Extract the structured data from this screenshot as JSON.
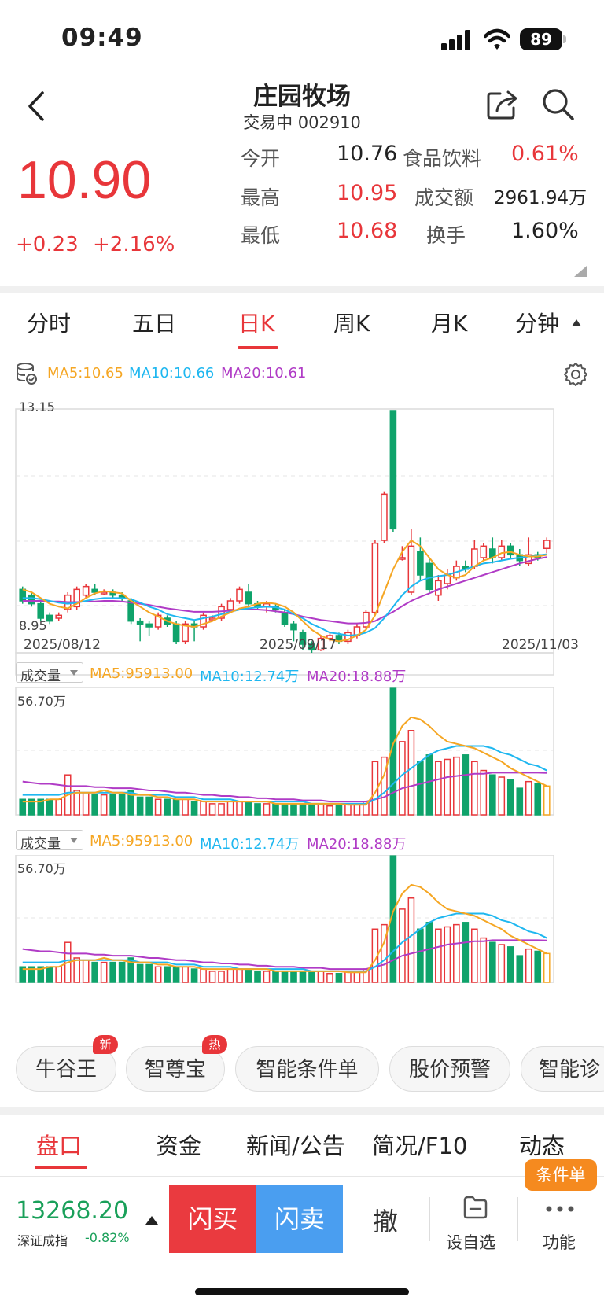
{
  "status": {
    "time": "09:49",
    "battery": "89"
  },
  "header": {
    "title": "庄园牧场",
    "subtitle": "交易中 002910"
  },
  "quote": {
    "price": "10.90",
    "change": "+0.23",
    "change_pct": "+2.16%",
    "open_label": "今开",
    "open": "10.76",
    "high_label": "最高",
    "high": "10.95",
    "low_label": "最低",
    "low": "10.68",
    "sector_label": "食品饮料",
    "sector_chg": "0.61%",
    "turnover_amt_label": "成交额",
    "turnover_amt": "2961.94万",
    "turnover_rate_label": "换手",
    "turnover_rate": "1.60%"
  },
  "tabs": [
    "分时",
    "五日",
    "日K",
    "周K",
    "月K",
    "分钟"
  ],
  "active_tab": "日K",
  "kline": {
    "ma5": "MA5:10.65",
    "ma10": "MA10:10.66",
    "ma20": "MA20:10.61",
    "ymax": "13.15",
    "ymin": "8.95",
    "dates": [
      "2025/08/12",
      "2025/09/17",
      "2025/11/03"
    ],
    "colors": {
      "up": "#e8363a",
      "down": "#0fa36b",
      "ma5": "#f5a623",
      "ma10": "#1eb7f0",
      "ma20": "#b03bc6"
    }
  },
  "volume1": {
    "selector": "成交量",
    "ma5": "MA5:95913.00",
    "ma10": "MA10:12.74万",
    "ma20": "MA20:18.88万",
    "ymax": "56.70万"
  },
  "volume2": {
    "selector": "成交量",
    "ma5": "MA5:95913.00",
    "ma10": "MA10:12.74万",
    "ma20": "MA20:18.88万",
    "ymax": "56.70万"
  },
  "chips": [
    {
      "label": "牛谷王",
      "badge": "新"
    },
    {
      "label": "智尊宝",
      "badge": "热"
    },
    {
      "label": "智能条件单",
      "badge": ""
    },
    {
      "label": "股价预警",
      "badge": ""
    },
    {
      "label": "智能诊",
      "badge": ""
    }
  ],
  "bottom_tabs": [
    "盘口",
    "资金",
    "新闻/公告",
    "简况/F10",
    "动态"
  ],
  "footer": {
    "index_value": "13268.20",
    "index_name": "深证成指",
    "index_chg": "-0.82%",
    "buy": "闪买",
    "sell": "闪卖",
    "cancel": "撤",
    "watch": "设自选",
    "func": "功能",
    "cond": "条件单"
  },
  "chart_data": {
    "type": "candlestick",
    "x_range": [
      "2025/08/12",
      "2025/11/03"
    ],
    "ylim": [
      8.95,
      13.15
    ],
    "candles": [
      {
        "o": 10.05,
        "c": 9.85,
        "h": 10.1,
        "l": 9.8
      },
      {
        "o": 9.95,
        "c": 9.8,
        "h": 10.0,
        "l": 9.75
      },
      {
        "o": 9.8,
        "c": 9.55,
        "h": 9.85,
        "l": 9.5
      },
      {
        "o": 9.6,
        "c": 9.5,
        "h": 9.65,
        "l": 9.45
      },
      {
        "o": 9.55,
        "c": 9.6,
        "h": 9.65,
        "l": 9.5
      },
      {
        "o": 9.7,
        "c": 9.95,
        "h": 10.0,
        "l": 9.65
      },
      {
        "o": 9.75,
        "c": 10.05,
        "h": 10.1,
        "l": 9.7
      },
      {
        "o": 9.95,
        "c": 10.1,
        "h": 10.15,
        "l": 9.9
      },
      {
        "o": 10.05,
        "c": 10.0,
        "h": 10.15,
        "l": 9.95
      },
      {
        "o": 10.0,
        "c": 10.0,
        "h": 10.05,
        "l": 9.95
      },
      {
        "o": 10.0,
        "c": 9.95,
        "h": 10.05,
        "l": 9.9
      },
      {
        "o": 9.95,
        "c": 9.9,
        "h": 10.0,
        "l": 9.85
      },
      {
        "o": 9.85,
        "c": 9.5,
        "h": 9.9,
        "l": 9.45
      },
      {
        "o": 9.5,
        "c": 9.45,
        "h": 9.55,
        "l": 9.15
      },
      {
        "o": 9.45,
        "c": 9.4,
        "h": 9.5,
        "l": 9.25
      },
      {
        "o": 9.4,
        "c": 9.6,
        "h": 9.65,
        "l": 9.35
      },
      {
        "o": 9.55,
        "c": 9.45,
        "h": 9.6,
        "l": 9.4
      },
      {
        "o": 9.45,
        "c": 9.15,
        "h": 9.5,
        "l": 9.1
      },
      {
        "o": 9.15,
        "c": 9.45,
        "h": 9.5,
        "l": 9.1
      },
      {
        "o": 9.45,
        "c": 9.4,
        "h": 9.5,
        "l": 9.15
      },
      {
        "o": 9.4,
        "c": 9.6,
        "h": 9.65,
        "l": 9.35
      },
      {
        "o": 9.55,
        "c": 9.55,
        "h": 9.6,
        "l": 9.5
      },
      {
        "o": 9.55,
        "c": 9.75,
        "h": 9.8,
        "l": 9.5
      },
      {
        "o": 9.7,
        "c": 9.85,
        "h": 9.9,
        "l": 9.65
      },
      {
        "o": 9.85,
        "c": 10.05,
        "h": 10.1,
        "l": 9.8
      },
      {
        "o": 10.0,
        "c": 9.8,
        "h": 10.15,
        "l": 9.75
      },
      {
        "o": 9.8,
        "c": 9.75,
        "h": 9.85,
        "l": 9.7
      },
      {
        "o": 9.75,
        "c": 9.8,
        "h": 9.85,
        "l": 9.65
      },
      {
        "o": 9.75,
        "c": 9.7,
        "h": 9.8,
        "l": 9.65
      },
      {
        "o": 9.65,
        "c": 9.45,
        "h": 9.7,
        "l": 9.4
      },
      {
        "o": 9.45,
        "c": 9.35,
        "h": 9.5,
        "l": 9.15
      },
      {
        "o": 9.3,
        "c": 9.1,
        "h": 9.35,
        "l": 9.0
      },
      {
        "o": 9.1,
        "c": 9.0,
        "h": 9.15,
        "l": 8.95
      },
      {
        "o": 9.0,
        "c": 9.2,
        "h": 9.25,
        "l": 8.98
      },
      {
        "o": 9.2,
        "c": 9.25,
        "h": 9.3,
        "l": 9.15
      },
      {
        "o": 9.25,
        "c": 9.15,
        "h": 9.3,
        "l": 9.1
      },
      {
        "o": 9.15,
        "c": 9.3,
        "h": 9.35,
        "l": 9.1
      },
      {
        "o": 9.25,
        "c": 9.4,
        "h": 9.45,
        "l": 9.2
      },
      {
        "o": 9.4,
        "c": 9.65,
        "h": 9.7,
        "l": 9.35
      },
      {
        "o": 9.65,
        "c": 10.85,
        "h": 10.9,
        "l": 9.6
      },
      {
        "o": 10.9,
        "c": 11.7,
        "h": 11.75,
        "l": 10.85
      },
      {
        "o": 13.15,
        "c": 11.1,
        "h": 13.15,
        "l": 11.05
      },
      {
        "o": 10.6,
        "c": 10.6,
        "h": 10.8,
        "l": 10.55
      },
      {
        "o": 10.0,
        "c": 10.8,
        "h": 11.1,
        "l": 9.95
      },
      {
        "o": 10.7,
        "c": 10.3,
        "h": 10.95,
        "l": 10.2
      },
      {
        "o": 10.5,
        "c": 10.05,
        "h": 10.6,
        "l": 10.0
      },
      {
        "o": 9.95,
        "c": 10.2,
        "h": 10.3,
        "l": 9.85
      },
      {
        "o": 10.15,
        "c": 10.3,
        "h": 10.4,
        "l": 10.05
      },
      {
        "o": 10.25,
        "c": 10.45,
        "h": 10.55,
        "l": 10.2
      },
      {
        "o": 10.45,
        "c": 10.4,
        "h": 10.55,
        "l": 10.35
      },
      {
        "o": 10.45,
        "c": 10.75,
        "h": 10.9,
        "l": 10.4
      },
      {
        "o": 10.6,
        "c": 10.8,
        "h": 10.85,
        "l": 10.55
      },
      {
        "o": 10.75,
        "c": 10.6,
        "h": 10.95,
        "l": 10.5
      },
      {
        "o": 10.6,
        "c": 10.8,
        "h": 10.9,
        "l": 10.55
      },
      {
        "o": 10.8,
        "c": 10.65,
        "h": 10.85,
        "l": 10.6
      },
      {
        "o": 10.65,
        "c": 10.55,
        "h": 10.75,
        "l": 10.45
      },
      {
        "o": 10.5,
        "c": 10.65,
        "h": 10.95,
        "l": 10.45
      },
      {
        "o": 10.65,
        "c": 10.6,
        "h": 10.7,
        "l": 10.55
      },
      {
        "o": 10.76,
        "c": 10.9,
        "h": 10.95,
        "l": 10.68
      }
    ],
    "ma5": [
      10.05,
      10.0,
      9.9,
      9.8,
      9.75,
      9.72,
      9.8,
      9.9,
      9.98,
      10.02,
      10.0,
      9.98,
      9.85,
      9.75,
      9.65,
      9.58,
      9.5,
      9.45,
      9.42,
      9.4,
      9.45,
      9.5,
      9.58,
      9.65,
      9.72,
      9.75,
      9.8,
      9.82,
      9.8,
      9.75,
      9.65,
      9.5,
      9.35,
      9.25,
      9.18,
      9.15,
      9.18,
      9.25,
      9.35,
      9.6,
      10.0,
      10.4,
      10.7,
      10.9,
      10.8,
      10.6,
      10.4,
      10.3,
      10.25,
      10.3,
      10.45,
      10.55,
      10.6,
      10.68,
      10.7,
      10.65,
      10.62,
      10.62,
      10.65
    ],
    "ma10": [
      9.9,
      9.9,
      9.88,
      9.85,
      9.82,
      9.8,
      9.82,
      9.85,
      9.88,
      9.9,
      9.9,
      9.9,
      9.88,
      9.82,
      9.75,
      9.7,
      9.62,
      9.58,
      9.55,
      9.52,
      9.55,
      9.58,
      9.62,
      9.66,
      9.7,
      9.72,
      9.74,
      9.75,
      9.74,
      9.7,
      9.62,
      9.55,
      9.45,
      9.38,
      9.3,
      9.28,
      9.25,
      9.26,
      9.3,
      9.38,
      9.55,
      9.75,
      9.95,
      10.1,
      10.2,
      10.25,
      10.28,
      10.3,
      10.35,
      10.4,
      10.45,
      10.5,
      10.52,
      10.55,
      10.58,
      10.6,
      10.62,
      10.64,
      10.66
    ],
    "ma20": [
      9.85,
      9.85,
      9.85,
      9.84,
      9.84,
      9.83,
      9.83,
      9.84,
      9.84,
      9.85,
      9.85,
      9.84,
      9.82,
      9.8,
      9.78,
      9.75,
      9.72,
      9.7,
      9.68,
      9.66,
      9.66,
      9.66,
      9.67,
      9.68,
      9.7,
      9.7,
      9.7,
      9.69,
      9.67,
      9.65,
      9.62,
      9.58,
      9.55,
      9.52,
      9.5,
      9.48,
      9.46,
      9.46,
      9.47,
      9.5,
      9.58,
      9.66,
      9.76,
      9.85,
      9.92,
      9.98,
      10.05,
      10.1,
      10.15,
      10.2,
      10.25,
      10.3,
      10.35,
      10.4,
      10.45,
      10.5,
      10.54,
      10.58,
      10.61
    ],
    "volume_ylim": [
      0,
      56.7
    ],
    "volume_unit": "万",
    "volume": [
      7,
      7,
      7,
      7,
      7,
      18,
      11,
      10,
      9,
      9,
      9,
      9,
      11,
      8,
      8,
      7,
      7,
      7,
      7,
      6,
      6,
      5,
      5,
      6,
      6,
      6,
      5,
      5,
      5,
      5,
      5,
      5,
      5,
      5,
      4,
      4,
      5,
      5,
      6,
      24,
      26,
      57,
      33,
      38,
      24,
      27,
      24,
      25,
      26,
      27,
      24,
      20,
      18,
      17,
      16,
      12,
      15,
      14,
      13
    ],
    "volume_ma5": [
      6,
      6,
      6,
      7,
      7,
      9,
      10,
      10,
      10,
      11,
      10,
      10,
      9,
      9,
      9,
      8,
      8,
      7,
      7,
      7,
      6,
      6,
      6,
      6,
      6,
      6,
      6,
      6,
      5,
      5,
      5,
      5,
      5,
      5,
      5,
      5,
      4.5,
      4.5,
      4.5,
      10,
      18,
      32,
      40,
      44,
      43,
      40,
      36,
      33,
      32,
      31,
      30,
      28,
      26,
      24,
      21,
      19,
      17,
      15,
      13
    ],
    "volume_ma10": [
      9,
      9,
      9,
      9,
      9,
      10,
      10,
      10,
      10,
      10,
      10,
      10,
      10,
      9,
      9,
      9,
      9,
      8,
      8,
      8,
      7,
      7,
      7,
      7,
      6,
      6,
      6,
      6,
      6,
      6,
      6,
      6,
      5,
      5,
      5,
      5,
      5,
      5,
      5,
      7,
      10,
      14,
      18,
      21,
      24,
      27,
      29,
      30,
      31,
      31,
      31,
      31,
      30,
      28,
      27,
      25,
      23,
      22,
      20
    ],
    "volume_ma20": [
      15,
      14.5,
      14,
      14,
      13.5,
      13,
      13,
      13,
      12.5,
      12.5,
      12,
      12,
      12,
      11.5,
      11,
      11,
      10.5,
      10,
      10,
      9.5,
      9,
      9,
      8.5,
      8.5,
      8,
      8,
      7.5,
      7.5,
      7,
      7,
      7,
      6.5,
      6.5,
      6.5,
      6,
      6,
      6,
      6,
      6,
      7,
      8,
      10,
      12,
      13,
      14,
      15,
      16,
      17,
      17.5,
      18,
      18.5,
      18.5,
      19,
      19,
      19,
      19,
      19,
      19,
      18.88
    ]
  }
}
